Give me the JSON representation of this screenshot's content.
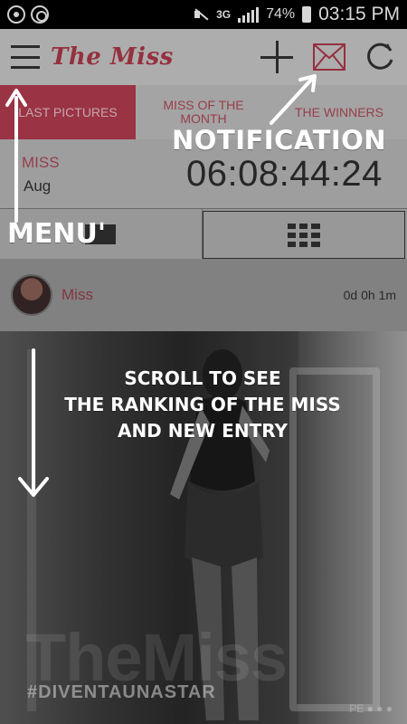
{
  "status_bar": {
    "network": "3G",
    "battery": "74%",
    "time": "03:15 PM"
  },
  "app_bar": {
    "logo": "The Miss"
  },
  "tabs": [
    {
      "label": "LAST PICTURES",
      "active": true
    },
    {
      "label": "MISS OF THE MONTH",
      "active": false
    },
    {
      "label": "THE WINNERS",
      "active": false
    }
  ],
  "contest": {
    "title": "MISS",
    "month": "Aug",
    "countdown": "06:08:44:24"
  },
  "post": {
    "author": "Miss",
    "time_ago": "0d 0h 1m"
  },
  "photo": {
    "watermark": "TheMiss",
    "hashtag": "#DIVENTAUNASTAR",
    "corner_text": "PE ● ● ●"
  },
  "annotations": {
    "notification": "NOTIFICATION",
    "menu": "MENU'",
    "scroll_line1": "SCROLL TO SEE",
    "scroll_line2": "THE RANKING OF THE MISS",
    "scroll_line3": "AND NEW ENTRY"
  },
  "colors": {
    "brand": "#b83d51",
    "appbar": "#cfcfcf",
    "text_dark": "#2e2e2e"
  }
}
